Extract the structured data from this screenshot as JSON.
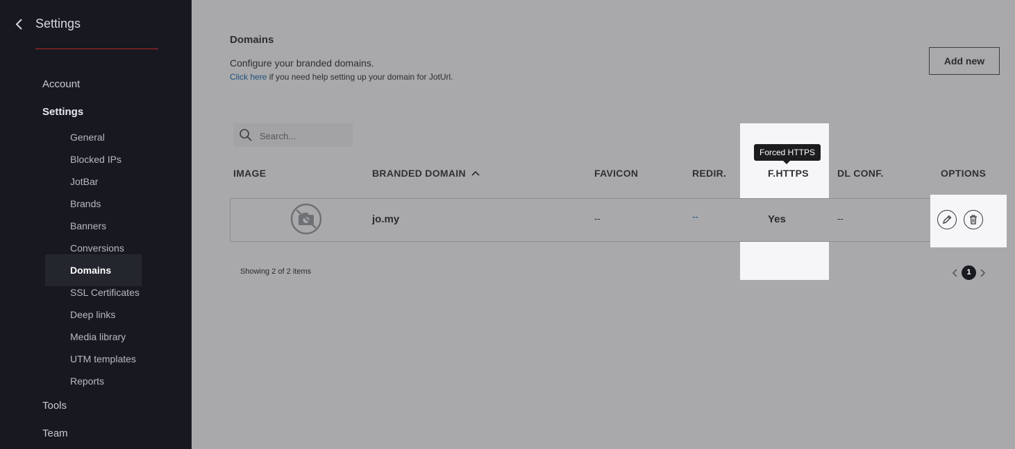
{
  "sidebar": {
    "title": "Settings",
    "items": {
      "account": "Account",
      "settings": "Settings",
      "tools": "Tools",
      "team": "Team"
    },
    "sub_items": [
      "General",
      "Blocked IPs",
      "JotBar",
      "Brands",
      "Banners",
      "Conversions",
      "Domains",
      "SSL Certificates",
      "Deep links",
      "Media library",
      "UTM templates",
      "Reports"
    ],
    "active_sub_item": "Domains"
  },
  "main": {
    "title": "Domains",
    "description": "Configure your branded domains.",
    "help_link": "Click here",
    "help_text": " if you need help setting up your domain for JotUrl.",
    "add_button": "Add new",
    "search_placeholder": "Search...",
    "columns": {
      "image": "IMAGE",
      "branded_domain": "BRANDED DOMAIN",
      "favicon": "FAVICON",
      "redir": "REDIR.",
      "fhttps": "F.HTTPS",
      "dlconf": "DL CONF.",
      "options": "OPTIONS"
    },
    "sort_column": "branded_domain",
    "sort_direction": "asc",
    "tooltip": "Forced HTTPS",
    "rows": [
      {
        "domain": "jo.my",
        "favicon": "--",
        "redir": "--",
        "fhttps": "Yes",
        "dlconf": "--"
      }
    ],
    "showing": "Showing 2 of 2 items",
    "current_page": "1"
  },
  "colors": {
    "sidebar_bg": "#181920",
    "accent_line": "#b8262c",
    "highlight": "#f6f6f8",
    "link": "#1f4f7d"
  }
}
